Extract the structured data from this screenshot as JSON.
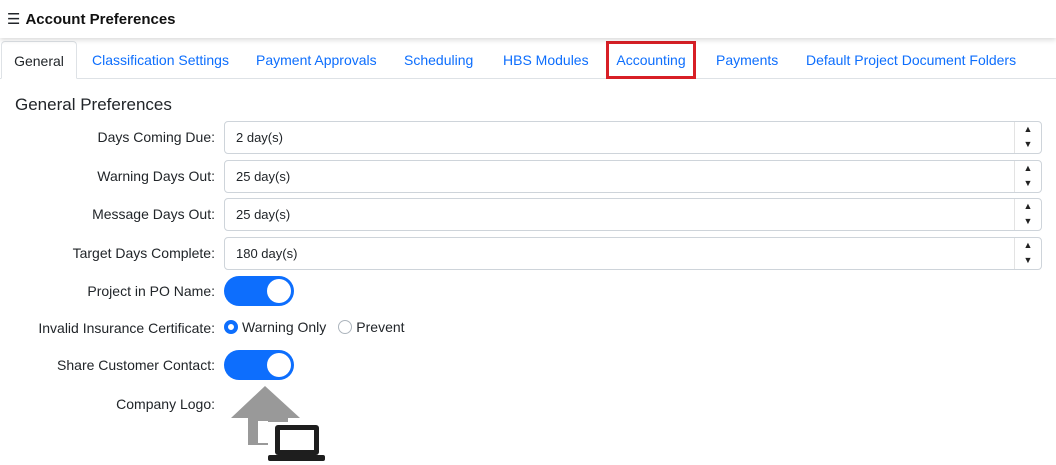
{
  "header": {
    "title": "Account Preferences",
    "menu_icon": "hamburger-icon"
  },
  "tabs": [
    {
      "label": "General",
      "active": true
    },
    {
      "label": "Classification Settings"
    },
    {
      "label": "Payment Approvals"
    },
    {
      "label": "Scheduling"
    },
    {
      "label": "HBS Modules"
    },
    {
      "label": "Accounting",
      "highlighted": true
    },
    {
      "label": "Payments"
    },
    {
      "label": "Default Project Document Folders"
    }
  ],
  "section": {
    "title": "General Preferences"
  },
  "fields": {
    "days_coming_due": {
      "label": "Days Coming Due:",
      "value": "2 day(s)"
    },
    "warning_days_out": {
      "label": "Warning Days Out:",
      "value": "25 day(s)"
    },
    "message_days_out": {
      "label": "Message Days Out:",
      "value": "25 day(s)"
    },
    "target_days_complete": {
      "label": "Target Days Complete:",
      "value": "180 day(s)"
    },
    "project_in_po_name": {
      "label": "Project in PO Name:",
      "on": true
    },
    "invalid_insurance_certificate": {
      "label": "Invalid Insurance Certificate:",
      "options": [
        "Warning Only",
        "Prevent"
      ],
      "selected": "Warning Only"
    },
    "share_customer_contact": {
      "label": "Share Customer Contact:",
      "on": true
    },
    "company_logo": {
      "label": "Company Logo:",
      "icon": "home-computer-icon"
    }
  },
  "colors": {
    "accent": "#0d6efd",
    "highlight_border": "#d81f26",
    "logo_gray": "#999999",
    "logo_dark": "#1e1e1e"
  }
}
